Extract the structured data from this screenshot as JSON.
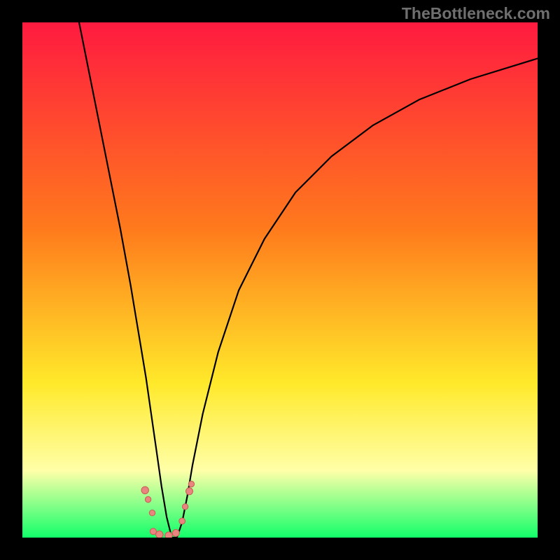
{
  "watermark": "TheBottleneck.com",
  "colors": {
    "frame": "#000000",
    "gradient_top": "#ff1a40",
    "gradient_mid1": "#ff7a1c",
    "gradient_mid2": "#ffe92a",
    "gradient_band": "#ffffa8",
    "gradient_bottom": "#12ff6a",
    "curve": "#000000",
    "marker_fill": "#e8857f",
    "marker_stroke": "#c85c55"
  },
  "chart_data": {
    "type": "line",
    "title": "",
    "xlabel": "",
    "ylabel": "",
    "xlim": [
      0,
      100
    ],
    "ylim": [
      0,
      100
    ],
    "series": [
      {
        "name": "curve",
        "x": [
          11,
          13,
          15,
          17,
          19,
          21,
          22,
          23,
          24,
          25,
          26,
          27,
          28,
          29,
          30,
          31,
          32,
          33,
          35,
          38,
          42,
          47,
          53,
          60,
          68,
          77,
          87,
          100
        ],
        "y": [
          100,
          90,
          80,
          70,
          60,
          49,
          43,
          37,
          31,
          24,
          17,
          10,
          4,
          0,
          0,
          3,
          8,
          14,
          24,
          36,
          48,
          58,
          67,
          74,
          80,
          85,
          89,
          93
        ]
      }
    ],
    "markers": [
      {
        "x": 23.8,
        "y": 9.2,
        "r": 5.2
      },
      {
        "x": 24.4,
        "y": 7.4,
        "r": 4.2
      },
      {
        "x": 25.2,
        "y": 4.8,
        "r": 4.2
      },
      {
        "x": 25.4,
        "y": 1.2,
        "r": 4.6
      },
      {
        "x": 26.6,
        "y": 0.6,
        "r": 5.2
      },
      {
        "x": 28.4,
        "y": 0.4,
        "r": 5.2
      },
      {
        "x": 29.8,
        "y": 0.9,
        "r": 5.0
      },
      {
        "x": 31.0,
        "y": 3.2,
        "r": 4.4
      },
      {
        "x": 31.6,
        "y": 6.0,
        "r": 4.2
      },
      {
        "x": 32.4,
        "y": 9.0,
        "r": 5.0
      },
      {
        "x": 32.8,
        "y": 10.4,
        "r": 4.2
      }
    ]
  }
}
